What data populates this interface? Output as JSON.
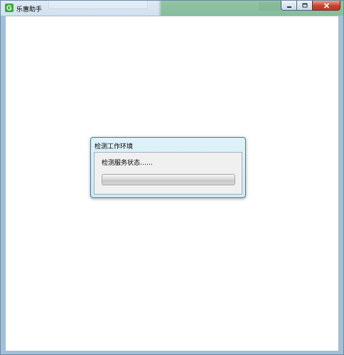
{
  "window": {
    "title": "乐惠助手",
    "icon": "app-logo-icon"
  },
  "dialog": {
    "title": "检测工作环境",
    "status": "检测服务状态……",
    "progress": 0
  },
  "colors": {
    "app_icon": "#3aa83a",
    "close_button": "#c7432c",
    "dialog_frame": "#cfe9f2"
  }
}
